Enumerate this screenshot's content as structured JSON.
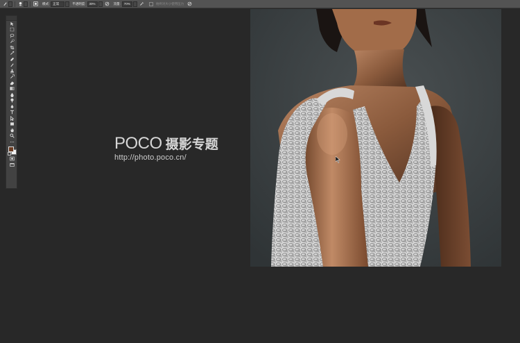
{
  "options_bar": {
    "mode_label": "模式:",
    "mode_value": "正常",
    "opacity_label": "不透明度:",
    "opacity_value": "30%",
    "flow_label": "流量:",
    "flow_value": "70%",
    "smoothing_label": "始终对大小使用压力"
  },
  "toolbar": {
    "tools": [
      "move-tool",
      "marquee-tool",
      "lasso-tool",
      "quick-selection-tool",
      "crop-tool",
      "eyedropper-tool",
      "healing-brush-tool",
      "brush-tool",
      "clone-stamp-tool",
      "history-brush-tool",
      "eraser-tool",
      "gradient-tool",
      "blur-tool",
      "dodge-tool",
      "pen-tool",
      "type-tool",
      "path-selection-tool",
      "shape-tool",
      "hand-tool",
      "zoom-tool"
    ],
    "foreground_color": "#6b3c22",
    "background_color": "#f2f2f2"
  },
  "watermark": {
    "logo": "POCO",
    "brand_cn": "摄影专题",
    "url": "http://photo.poco.cn/"
  }
}
